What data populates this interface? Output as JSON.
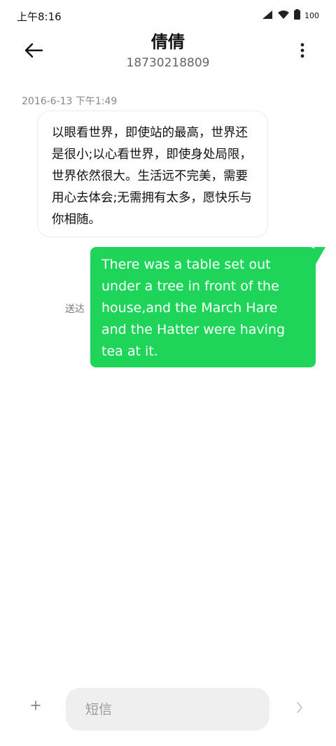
{
  "status_bar": {
    "time": "上午8:16",
    "battery": "100"
  },
  "header": {
    "contact_name": "倩倩",
    "phone_number": "18730218809"
  },
  "conversation": {
    "timestamp": "2016-6-13 下午1:49",
    "incoming_message": "以眼看世界，即使站的最高，世界还是很小;以心看世界，即使身处局限，世界依然很大。生活远不完美，需要用心去体会;无需拥有太多，愿快乐与你相随。",
    "outgoing_message": "There was a table set out under a tree in front of the house,and the March Hare and the Hatter were having tea at it.",
    "outgoing_status": "送达"
  },
  "composer": {
    "placeholder": "短信"
  },
  "colors": {
    "outgoing_bubble": "#1ed55a",
    "incoming_bubble_border": "#ececec"
  },
  "icons": [
    "signal-icon",
    "wifi-icon",
    "battery-icon",
    "back-arrow-icon",
    "more-vertical-icon",
    "plus-icon",
    "send-chevron-icon"
  ]
}
